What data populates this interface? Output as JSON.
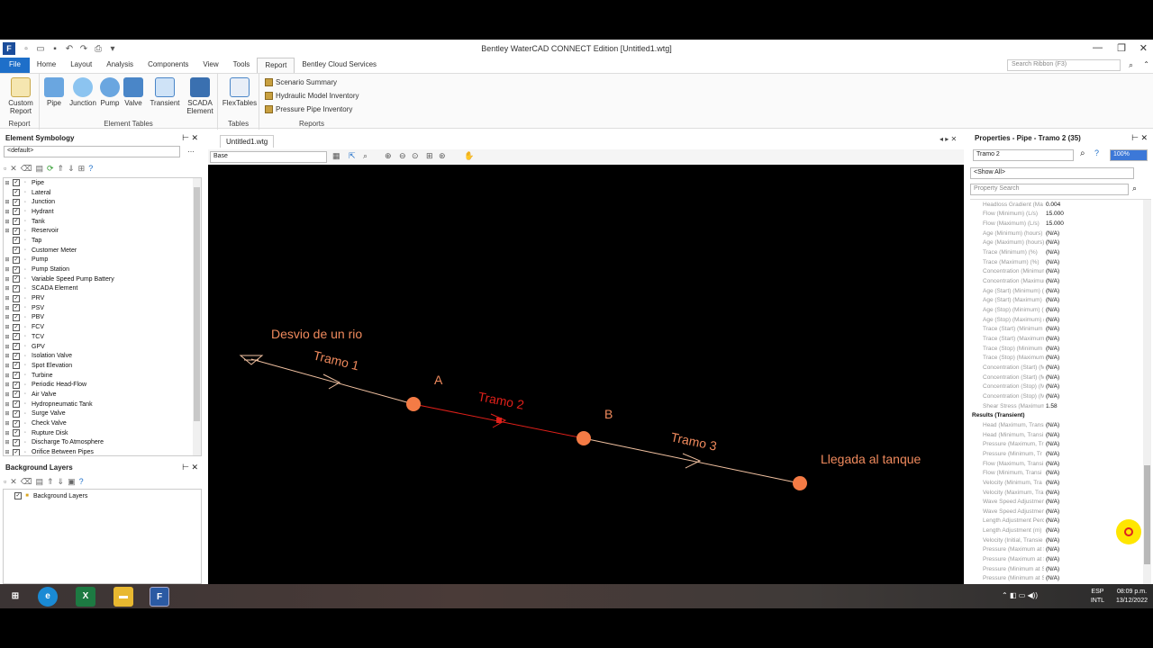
{
  "window": {
    "title": "Bentley WaterCAD CONNECT Edition [Untitled1.wtg]"
  },
  "ribbon": {
    "tabs": [
      "File",
      "Home",
      "Layout",
      "Analysis",
      "Components",
      "View",
      "Tools",
      "Report",
      "Bentley Cloud Services"
    ],
    "active_tab": "Report",
    "search_placeholder": "Search Ribbon (F3)",
    "groups": {
      "report": {
        "name": "Report",
        "custom_report": "Custom Report"
      },
      "element_tables": {
        "name": "Element Tables",
        "pipe": "Pipe",
        "junction": "Junction",
        "pump": "Pump",
        "valve": "Valve",
        "transient": "Transient",
        "scada": "SCADA Element"
      },
      "tables": {
        "name": "Tables",
        "flextables": "FlexTables"
      },
      "reports": {
        "name": "Reports",
        "items": [
          "Scenario Summary",
          "Hydraulic Model Inventory",
          "Pressure Pipe Inventory"
        ]
      }
    }
  },
  "symbology": {
    "title": "Element Symbology",
    "selected": "<default>",
    "items": [
      "Pipe",
      "Lateral",
      "Junction",
      "Hydrant",
      "Tank",
      "Reservoir",
      "Tap",
      "Customer Meter",
      "Pump",
      "Pump Station",
      "Variable Speed Pump Battery",
      "SCADA Element",
      "PRV",
      "PSV",
      "PBV",
      "FCV",
      "TCV",
      "GPV",
      "Isolation Valve",
      "Spot Elevation",
      "Turbine",
      "Periodic Head-Flow",
      "Air Valve",
      "Hydropneumatic Tank",
      "Surge Valve",
      "Check Valve",
      "Rupture Disk",
      "Discharge To Atmosphere",
      "Orifice Between Pipes"
    ]
  },
  "background_layers": {
    "title": "Background Layers",
    "root": "Background Layers"
  },
  "document": {
    "tab": "Untitled1.wtg",
    "layer": "Base"
  },
  "drawing": {
    "labels": {
      "title": "Desvio de un rio",
      "tramo1": "Tramo 1",
      "tramo2": "Tramo 2",
      "tramo3": "Tramo 3",
      "nodeA": "A",
      "nodeB": "B",
      "end": "Llegada al tanque"
    },
    "colors": {
      "label": "#f08a5d",
      "pipe": "#f0c0a0",
      "selected_pipe": "#e0201a",
      "node": "#f47b45"
    }
  },
  "properties": {
    "title": "Properties - Pipe - Tramo 2 (35)",
    "element": "Tramo 2",
    "zoom": "100%",
    "filter": "<Show All>",
    "search_placeholder": "Property Search",
    "rows": [
      {
        "name": "Headloss Gradient (Ma",
        "value": "0.004"
      },
      {
        "name": "Flow (Minimum) (L/s)",
        "value": "15.000"
      },
      {
        "name": "Flow (Maximum) (L/s)",
        "value": "15.000"
      },
      {
        "name": "Age (Minimum) (hours)",
        "value": "(N/A)"
      },
      {
        "name": "Age (Maximum) (hours)",
        "value": "(N/A)"
      },
      {
        "name": "Trace (Minimum) (%)",
        "value": "(N/A)"
      },
      {
        "name": "Trace (Maximum) (%)",
        "value": "(N/A)"
      },
      {
        "name": "Concentration (Minimum",
        "value": "(N/A)"
      },
      {
        "name": "Concentration (Maximum",
        "value": "(N/A)"
      },
      {
        "name": "Age (Start) (Minimum) (",
        "value": "(N/A)"
      },
      {
        "name": "Age (Start) (Maximum) (",
        "value": "(N/A)"
      },
      {
        "name": "Age (Stop) (Minimum) (",
        "value": "(N/A)"
      },
      {
        "name": "Age (Stop) (Maximum) (",
        "value": "(N/A)"
      },
      {
        "name": "Trace (Start) (Minimum",
        "value": "(N/A)"
      },
      {
        "name": "Trace (Start) (Maximum",
        "value": "(N/A)"
      },
      {
        "name": "Trace (Stop) (Minimum",
        "value": "(N/A)"
      },
      {
        "name": "Trace (Stop) (Maximum",
        "value": "(N/A)"
      },
      {
        "name": "Concentration (Start) (M",
        "value": "(N/A)"
      },
      {
        "name": "Concentration (Start) (M",
        "value": "(N/A)"
      },
      {
        "name": "Concentration (Stop) (M",
        "value": "(N/A)"
      },
      {
        "name": "Concentration (Stop) (M",
        "value": "(N/A)"
      },
      {
        "name": "Shear Stress (Maximum",
        "value": "1.58"
      },
      {
        "name": "Results (Transient)",
        "value": "",
        "category": true
      },
      {
        "name": "Head (Maximum, Transi",
        "value": "(N/A)"
      },
      {
        "name": "Head (Minimum, Transi",
        "value": "(N/A)"
      },
      {
        "name": "Pressure (Maximum, Tr",
        "value": "(N/A)"
      },
      {
        "name": "Pressure (Minimum, Tr",
        "value": "(N/A)"
      },
      {
        "name": "Flow (Maximum, Transi",
        "value": "(N/A)"
      },
      {
        "name": "Flow (Minimum, Transi",
        "value": "(N/A)"
      },
      {
        "name": "Velocity (Minimum, Tra",
        "value": "(N/A)"
      },
      {
        "name": "Velocity (Maximum, Tra",
        "value": "(N/A)"
      },
      {
        "name": "Wave Speed Adjustmen",
        "value": "(N/A)"
      },
      {
        "name": "Wave Speed Adjustmen",
        "value": "(N/A)"
      },
      {
        "name": "Length Adjustment Perc",
        "value": "(N/A)"
      },
      {
        "name": "Length Adjustment (m)",
        "value": "(N/A)"
      },
      {
        "name": "Velocity (Initial, Transie",
        "value": "(N/A)"
      },
      {
        "name": "Pressure (Maximum at S",
        "value": "(N/A)"
      },
      {
        "name": "Pressure (Maximum at S",
        "value": "(N/A)"
      },
      {
        "name": "Pressure (Minimum at S",
        "value": "(N/A)"
      },
      {
        "name": "Pressure (Minimum at S",
        "value": "(N/A)"
      }
    ]
  },
  "taskbar": {
    "lang1": "ESP",
    "lang2": "INTL",
    "time": "08:09 p.m.",
    "date": "13/12/2022"
  }
}
